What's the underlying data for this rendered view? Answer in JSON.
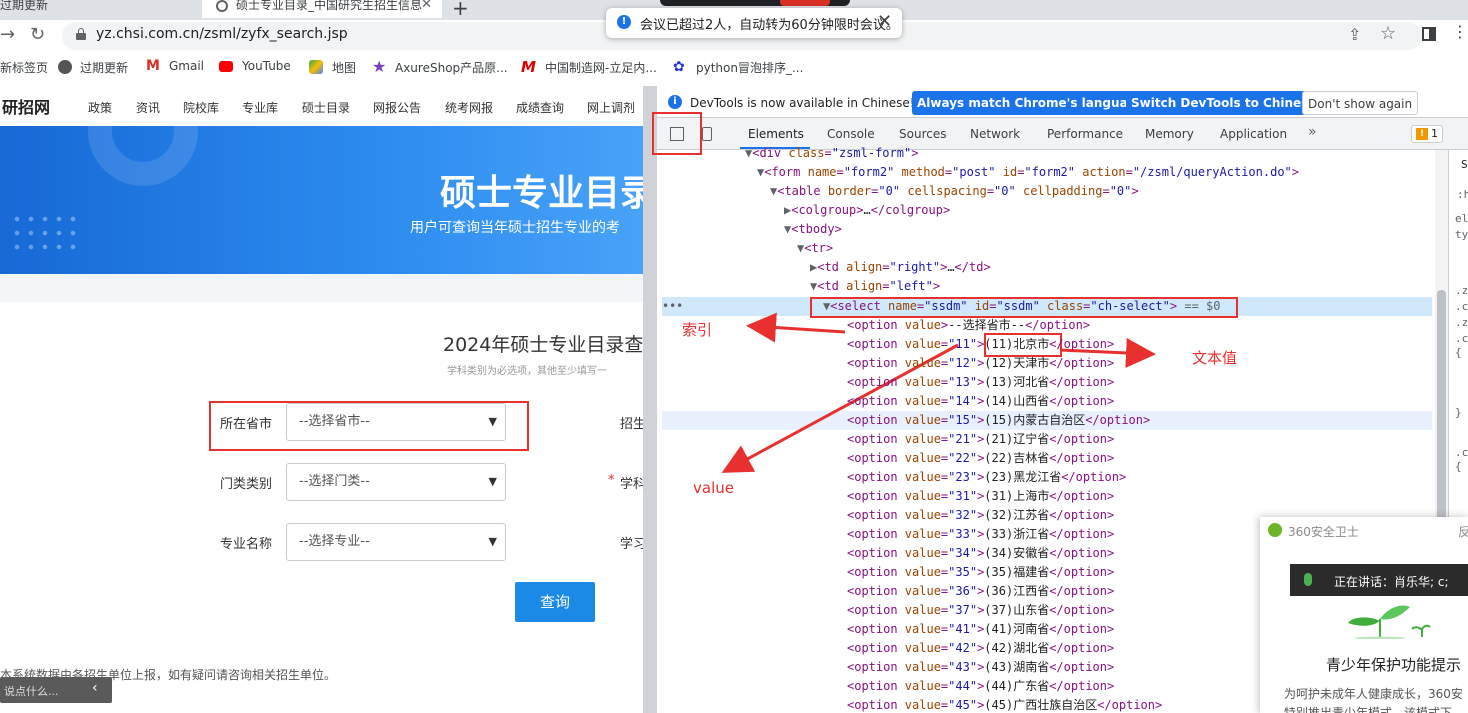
{
  "browser": {
    "tabs": [
      {
        "title": "过期更新"
      },
      {
        "title": "硕士专业目录_中国研究生招生信息"
      }
    ],
    "url": "yz.chsi.com.cn/zsml/zyfx_search.jsp",
    "toast": "会议已超过2人，自动转为60分钟限时会议。",
    "bookmarks": [
      {
        "label": "新标签页"
      },
      {
        "label": "过期更新"
      },
      {
        "label": "Gmail"
      },
      {
        "label": "YouTube"
      },
      {
        "label": "地图"
      },
      {
        "label": "AxureShop产品原..."
      },
      {
        "label": "中国制造网-立足内..."
      },
      {
        "label": "python冒泡排序_..."
      }
    ]
  },
  "page": {
    "logo": "研招网",
    "nav": [
      "政策",
      "资讯",
      "院校库",
      "专业库",
      "硕士目录",
      "网报公告",
      "统考网报",
      "成绩查询",
      "网上调剂"
    ],
    "banner_title": "硕士专业目录",
    "banner_subtitle": "用户可查询当年硕士招生专业的考",
    "form_title": "2024年硕士专业目录查",
    "form_hint": "学科类别为必选项，其他至少填写一",
    "fields": [
      {
        "label": "所在省市",
        "value": "--选择省市--"
      },
      {
        "label": "门类类别",
        "value": "--选择门类--"
      },
      {
        "label": "专业名称",
        "value": "--选择专业--"
      }
    ],
    "right_labels": [
      "招生",
      "学科",
      "学习"
    ],
    "required_mark": "*",
    "query_button": "查询",
    "footer": "本系统数据由各招生单位上报，如有疑问请咨询相关招生单位。",
    "say_placeholder": "说点什么..."
  },
  "devtools": {
    "banner_text": "DevTools is now available in Chinese!",
    "btn_match": "Always match Chrome's language",
    "btn_switch": "Switch DevTools to Chinese",
    "btn_dismiss": "Don't show again",
    "tabs": [
      "Elements",
      "Console",
      "Sources",
      "Network",
      "Performance",
      "Memory",
      "Application"
    ],
    "more": "»",
    "issues_count": "1",
    "selected_suffix": "== $0",
    "options": [
      {
        "value": "",
        "text": "--选择省市--"
      },
      {
        "value": "11",
        "text": "(11)北京市"
      },
      {
        "value": "12",
        "text": "(12)天津市"
      },
      {
        "value": "13",
        "text": "(13)河北省"
      },
      {
        "value": "14",
        "text": "(14)山西省"
      },
      {
        "value": "15",
        "text": "(15)内蒙古自治区"
      },
      {
        "value": "21",
        "text": "(21)辽宁省"
      },
      {
        "value": "22",
        "text": "(22)吉林省"
      },
      {
        "value": "23",
        "text": "(23)黑龙江省"
      },
      {
        "value": "31",
        "text": "(31)上海市"
      },
      {
        "value": "32",
        "text": "(32)江苏省"
      },
      {
        "value": "33",
        "text": "(33)浙江省"
      },
      {
        "value": "34",
        "text": "(34)安徽省"
      },
      {
        "value": "35",
        "text": "(35)福建省"
      },
      {
        "value": "36",
        "text": "(36)江西省"
      },
      {
        "value": "37",
        "text": "(37)山东省"
      },
      {
        "value": "41",
        "text": "(41)河南省"
      },
      {
        "value": "42",
        "text": "(42)湖北省"
      },
      {
        "value": "43",
        "text": "(43)湖南省"
      },
      {
        "value": "44",
        "text": "(44)广东省"
      },
      {
        "value": "45",
        "text": "(45)广西壮族自治区"
      }
    ]
  },
  "annotations": {
    "index": "索引",
    "text_value": "文本值",
    "value": "value"
  },
  "popup": {
    "title": "360安全卫士",
    "feedback": "反",
    "speech": "正在讲话：肖乐华; c;",
    "heading": "青少年保护功能提示",
    "body": "为呵护未成年人健康成长，360安",
    "body2": "特别推出青少年模式，该模式下"
  },
  "colors": {
    "accent": "#1a73e8",
    "banner": "#2d8cf0",
    "annotation": "#e8302f",
    "query_button": "#1a8ae6"
  }
}
